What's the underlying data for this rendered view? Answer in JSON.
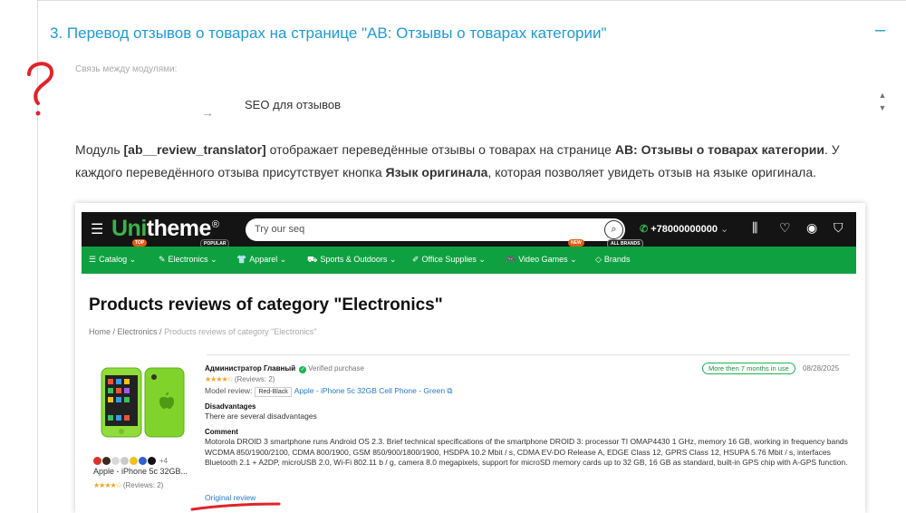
{
  "accordion": {
    "title": "3. Перевод отзывов о товарах на странице \"АВ: Отзывы о товарах категории\"",
    "toggle": "–"
  },
  "relation": {
    "label": "Связь между модулями:",
    "arrow": "→",
    "module": "SEO для отзывов"
  },
  "description": {
    "p1": "Модуль ",
    "b1": "[ab__review_translator]",
    "p2": " отображает переведённые отзывы о товарах на странице ",
    "b2": "АВ: Отзывы о товарах категории",
    "p3": ". У каждого переведённого отзыва присутствует кнопка ",
    "b3": "Язык оригинала",
    "p4": ", которая позволяет увидеть отзыв на языке оригинала."
  },
  "scroll": {
    "up": "▲",
    "down": "▼"
  },
  "store": {
    "logo_green": "Uni",
    "logo_white": "theme",
    "logo_reg": "®",
    "search_value": "Try our seq",
    "phone": "+78000000000",
    "phone_caret": "⌄",
    "nav": [
      {
        "label": "Catalog ⌄",
        "icon": "☰"
      },
      {
        "label": "Electronics ⌄",
        "icon": "✎"
      },
      {
        "label": "Apparel ⌄",
        "icon": "👕"
      },
      {
        "label": "Sports & Outdoors ⌄",
        "icon": "⛟"
      },
      {
        "label": "Office Supplies ⌄",
        "icon": "✐"
      },
      {
        "label": "Video Games ⌄",
        "icon": "🎮"
      },
      {
        "label": "Brands",
        "icon": "◇"
      }
    ],
    "badges": {
      "top": "TOP",
      "popular": "POPULAR",
      "new": "NEW",
      "all_brands": "ALL BRANDS"
    },
    "page_title": "Products reviews of category \"Electronics\"",
    "breadcrumbs": {
      "home": "Home",
      "sep": " / ",
      "cat": "Electronics",
      "current": "Products reviews of category \"Electronics\""
    },
    "product": {
      "name": "Apple - iPhone 5c 32GB...",
      "stars": "★★★★☆",
      "reviews": "(Reviews: 2)",
      "more_colors": "+4",
      "swatch_colors": [
        "#d9342b",
        "#3a2a1f",
        "#d8d8d8",
        "#c9c9c9",
        "#f2c21b",
        "#2f5fd0",
        "#111111"
      ]
    },
    "review": {
      "author": "Администратор Главный",
      "verified": "Verified purchase",
      "stars": "★★★★☆",
      "reviews": "(Reviews: 2)",
      "time_badge": "More then 7 months in use",
      "date": "08/28/2025",
      "model_label": "Model review:",
      "model_tag": "Red-Black",
      "model_link": "Apple - iPhone 5c 32GB Cell Phone - Green ⧉",
      "disadv_h": "Disadvantages",
      "disadv_t": "There are several disadvantages",
      "comment_h": "Comment",
      "comment_t": "Motorola DROID 3 smartphone runs Android OS 2.3. Brief technical specifications of the smartphone DROID 3: processor TI OMAP4430 1 GHz, memory 16 GB, working in frequency bands WCDMA 850/1900/2100, CDMA 800/1900, GSM 850/900/1800/1900, HSDPA 10.2 Mbit / s, CDMA EV-DO Release A, EDGE Class 12, GPRS Class 12, HSUPA 5.76 Mbit / s, interfaces Bluetooth 2.1 + A2DP, microUSB 2.0, Wi-Fi 802.11 b / g, camera 8.0 megapixels, support for microSD memory cards up to 32 GB, 16 GB as standard, built-in GPS chip with A-GPS function.",
      "original": "Original review"
    }
  },
  "colors": {
    "accent": "#1e9ad6",
    "nav_green": "#0fa141",
    "annotation_red": "#e0232b"
  }
}
